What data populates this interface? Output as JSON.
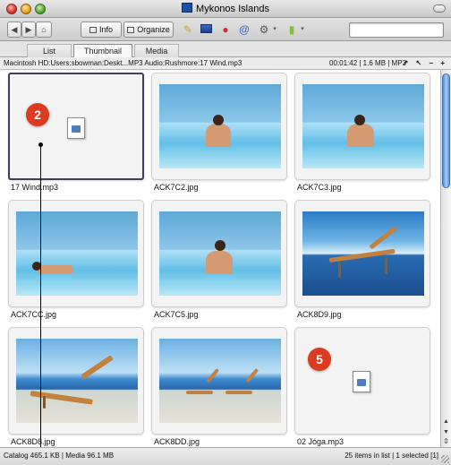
{
  "window": {
    "title": "Mykonos Islands"
  },
  "toolbar": {
    "info_label": "Info",
    "organize_label": "Organize",
    "search_value": ""
  },
  "tabs": [
    {
      "label": "List"
    },
    {
      "label": "Thumbnail",
      "active": true
    },
    {
      "label": "Media"
    }
  ],
  "pathbar": {
    "path": "Macintosh HD:Users:sbowman:Deskt...MP3 Audio:Rushmore:17 Wind.mp3",
    "meta": "00:01:42  |  1.6 MB  |  MP3",
    "controls": "↗ ↖ − +"
  },
  "items": [
    {
      "filename": "17 Wind.mp3",
      "kind": "audio",
      "selected": true,
      "badge": "2"
    },
    {
      "filename": "ACK7C2.jpg",
      "kind": "pool-woman"
    },
    {
      "filename": "ACK7C3.jpg",
      "kind": "pool-woman"
    },
    {
      "filename": "ACK7CC.jpg",
      "kind": "pool-lying"
    },
    {
      "filename": "ACK7C5.jpg",
      "kind": "pool-woman"
    },
    {
      "filename": "ACK8D9.jpg",
      "kind": "chair-sea"
    },
    {
      "filename": "ACK8D8.jpg",
      "kind": "chair-deck"
    },
    {
      "filename": "ACK8DD.jpg",
      "kind": "chairs-beach"
    },
    {
      "filename": "02 Jóga.mp3",
      "kind": "audio",
      "badge": "5"
    }
  ],
  "statusbar": {
    "left": "Catalog  465.1 KB  |  Media 96.1 MB",
    "right": "25 items in list  |  1 selected [1]"
  },
  "colors": {
    "badge": "#dd3b1f",
    "selection_border": "#3f3f5a",
    "scroll_thumb": "#4f8cd6"
  }
}
